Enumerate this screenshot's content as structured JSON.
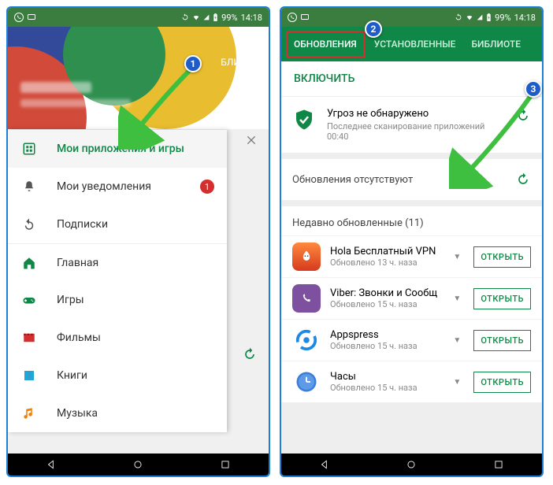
{
  "statusbar": {
    "battery": "99%",
    "time": "14:18"
  },
  "phone1": {
    "bg_tab_partial": "БЛИОТЕ",
    "menu": {
      "apps": "Мои приложения и игры",
      "notifications": "Мои уведомления",
      "notifications_badge": "1",
      "subscriptions": "Подписки",
      "home": "Главная",
      "games": "Игры",
      "movies": "Фильмы",
      "books": "Книги",
      "music": "Музыка"
    }
  },
  "phone2": {
    "tabs": {
      "updates": "ОБНОВЛЕНИЯ",
      "installed": "УСТАНОВЛЕННЫЕ",
      "library": "БИБЛИОТЕ"
    },
    "enable": "ВКЛЮЧИТЬ",
    "scan": {
      "title": "Угроз не обнаружено",
      "subtitle": "Последнее сканирование приложений 00:40"
    },
    "no_updates": "Обновления отсутствуют",
    "recent_header": "Недавно обновленные (11)",
    "open_btn": "ОТКРЫТЬ",
    "apps": [
      {
        "name": "Hola Бесплатный VPN",
        "sub": "Обновлено 13 ч. наза"
      },
      {
        "name": "Viber: Звонки и Сообщ",
        "sub": "Обновлено 15 ч. наза"
      },
      {
        "name": "Appspress",
        "sub": "Обновлено 15 ч. наза"
      },
      {
        "name": "Часы",
        "sub": "Обновлено 15 ч. наза"
      }
    ]
  },
  "callouts": {
    "c1": "1",
    "c2": "2",
    "c3": "3"
  }
}
